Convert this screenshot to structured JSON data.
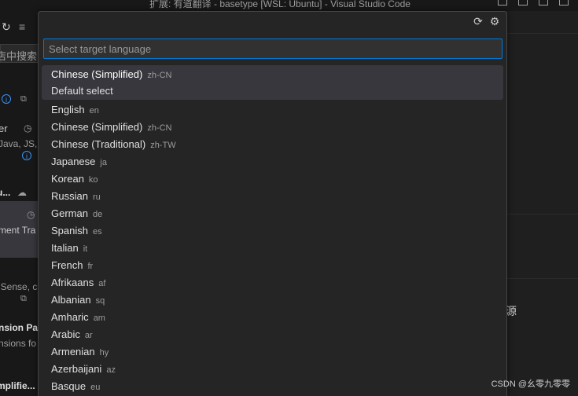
{
  "window": {
    "title": "扩展: 有道翻译 - basetype [WSL: Ubuntu] - Visual Studio Code"
  },
  "sidebar_fragments": {
    "search_placeholder": "店中搜索",
    "ext1_author": "er",
    "ext1_desc": "Java, JS,",
    "ext2_title": "u...",
    "ext2_desc": "ment Tra",
    "ext3_desc": "iSense, c",
    "ext4_title": "nsion Pa",
    "ext4_desc": "nsions fo",
    "ext5_title": "mplifie..."
  },
  "right_fragments": {
    "char": "源"
  },
  "quick_pick": {
    "input_placeholder": "Select target language",
    "icons": [
      "refresh-icon",
      "gear-icon"
    ],
    "items": [
      {
        "label": "Chinese (Simplified)",
        "code": "zh-CN",
        "description": "Default select",
        "active": true
      },
      {
        "label": "English",
        "code": "en"
      },
      {
        "label": "Chinese (Simplified)",
        "code": "zh-CN"
      },
      {
        "label": "Chinese (Traditional)",
        "code": "zh-TW"
      },
      {
        "label": "Japanese",
        "code": "ja"
      },
      {
        "label": "Korean",
        "code": "ko"
      },
      {
        "label": "Russian",
        "code": "ru"
      },
      {
        "label": "German",
        "code": "de"
      },
      {
        "label": "Spanish",
        "code": "es"
      },
      {
        "label": "Italian",
        "code": "it"
      },
      {
        "label": "French",
        "code": "fr"
      },
      {
        "label": "Afrikaans",
        "code": "af"
      },
      {
        "label": "Albanian",
        "code": "sq"
      },
      {
        "label": "Amharic",
        "code": "am"
      },
      {
        "label": "Arabic",
        "code": "ar"
      },
      {
        "label": "Armenian",
        "code": "hy"
      },
      {
        "label": "Azerbaijani",
        "code": "az"
      },
      {
        "label": "Basque",
        "code": "eu"
      }
    ]
  },
  "watermark": "CSDN @幺零九零零"
}
